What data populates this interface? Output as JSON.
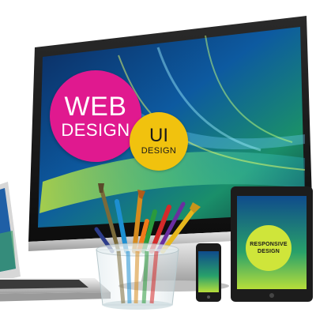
{
  "badges": {
    "web_design": {
      "line1": "WEB",
      "line2": "DESIGN",
      "color": "#e0198f"
    },
    "ui_design": {
      "line1": "UI",
      "line2": "DESIGN",
      "color": "#f1c20e"
    },
    "responsive_design": {
      "line1": "RESPONSIVE",
      "line2": "DESIGN",
      "color": "#cfe53a"
    }
  },
  "scene": {
    "objects": [
      "desktop-monitor",
      "laptop",
      "tablet",
      "smartphone",
      "pencil-and-brush-cup"
    ]
  }
}
